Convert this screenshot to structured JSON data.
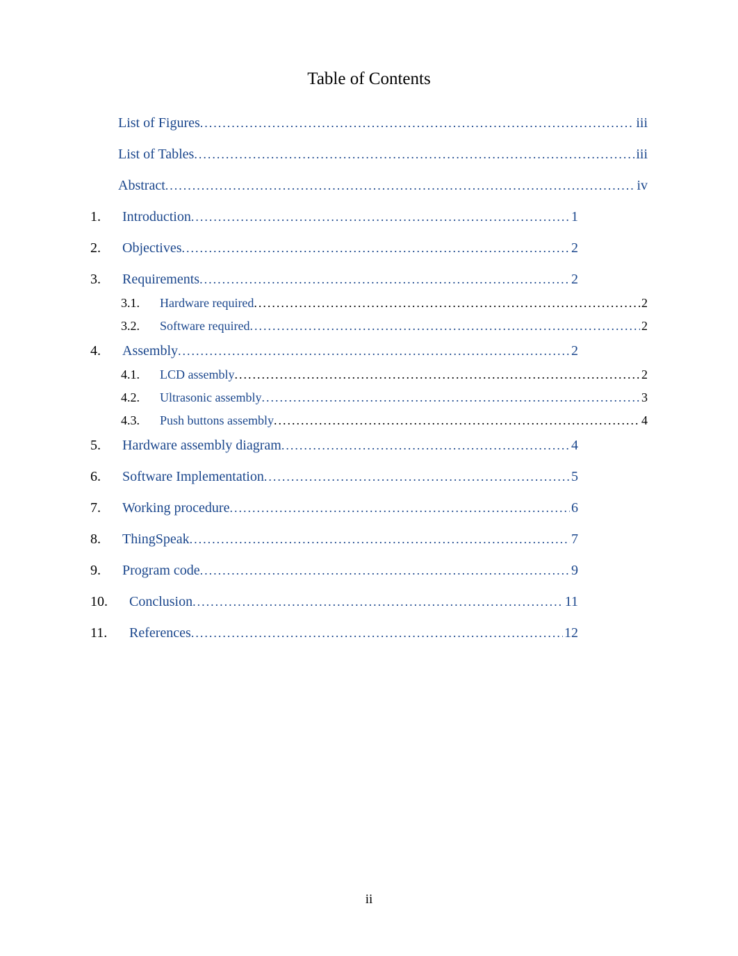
{
  "title": "Table of Contents",
  "colors": {
    "link": "#1a468c"
  },
  "entries": [
    {
      "type": "front",
      "label": "List of Figures",
      "page": "iii"
    },
    {
      "type": "front",
      "label": "List of Tables",
      "page": "iii"
    },
    {
      "type": "front",
      "label": "Abstract",
      "page": "iv"
    },
    {
      "type": "section",
      "num": "1.",
      "label": "Introduction",
      "page": "1"
    },
    {
      "type": "section",
      "num": "2.",
      "label": "Objectives",
      "page": "2"
    },
    {
      "type": "section",
      "num": "3.",
      "label": "Requirements",
      "page": "2",
      "children": [
        {
          "num": "3.1.",
          "label": "Hardware required",
          "page": "2"
        },
        {
          "num": "3.2.",
          "label": "Software required",
          "page": "2"
        }
      ]
    },
    {
      "type": "section",
      "num": "4.",
      "label": "Assembly",
      "page": "2",
      "children": [
        {
          "num": "4.1.",
          "label": "LCD assembly",
          "page": "2"
        },
        {
          "num": "4.2.",
          "label": "Ultrasonic assembly",
          "page": "3"
        },
        {
          "num": "4.3.",
          "label": "Push buttons assembly",
          "page": "4"
        }
      ]
    },
    {
      "type": "section",
      "num": "5.",
      "label": "Hardware assembly diagram",
      "page": "4"
    },
    {
      "type": "section",
      "num": "6.",
      "label": "Software Implementation",
      "page": "5"
    },
    {
      "type": "section",
      "num": "7.",
      "label": "Working procedure",
      "page": "6"
    },
    {
      "type": "section",
      "num": "8.",
      "label": "ThingSpeak",
      "page": "7"
    },
    {
      "type": "section",
      "num": "9.",
      "label": "Program code",
      "page": "9"
    },
    {
      "type": "section",
      "num": "10.",
      "label": "Conclusion",
      "page": "11"
    },
    {
      "type": "section",
      "num": "11.",
      "label": "References",
      "page": "12"
    }
  ],
  "page_number": "ii"
}
